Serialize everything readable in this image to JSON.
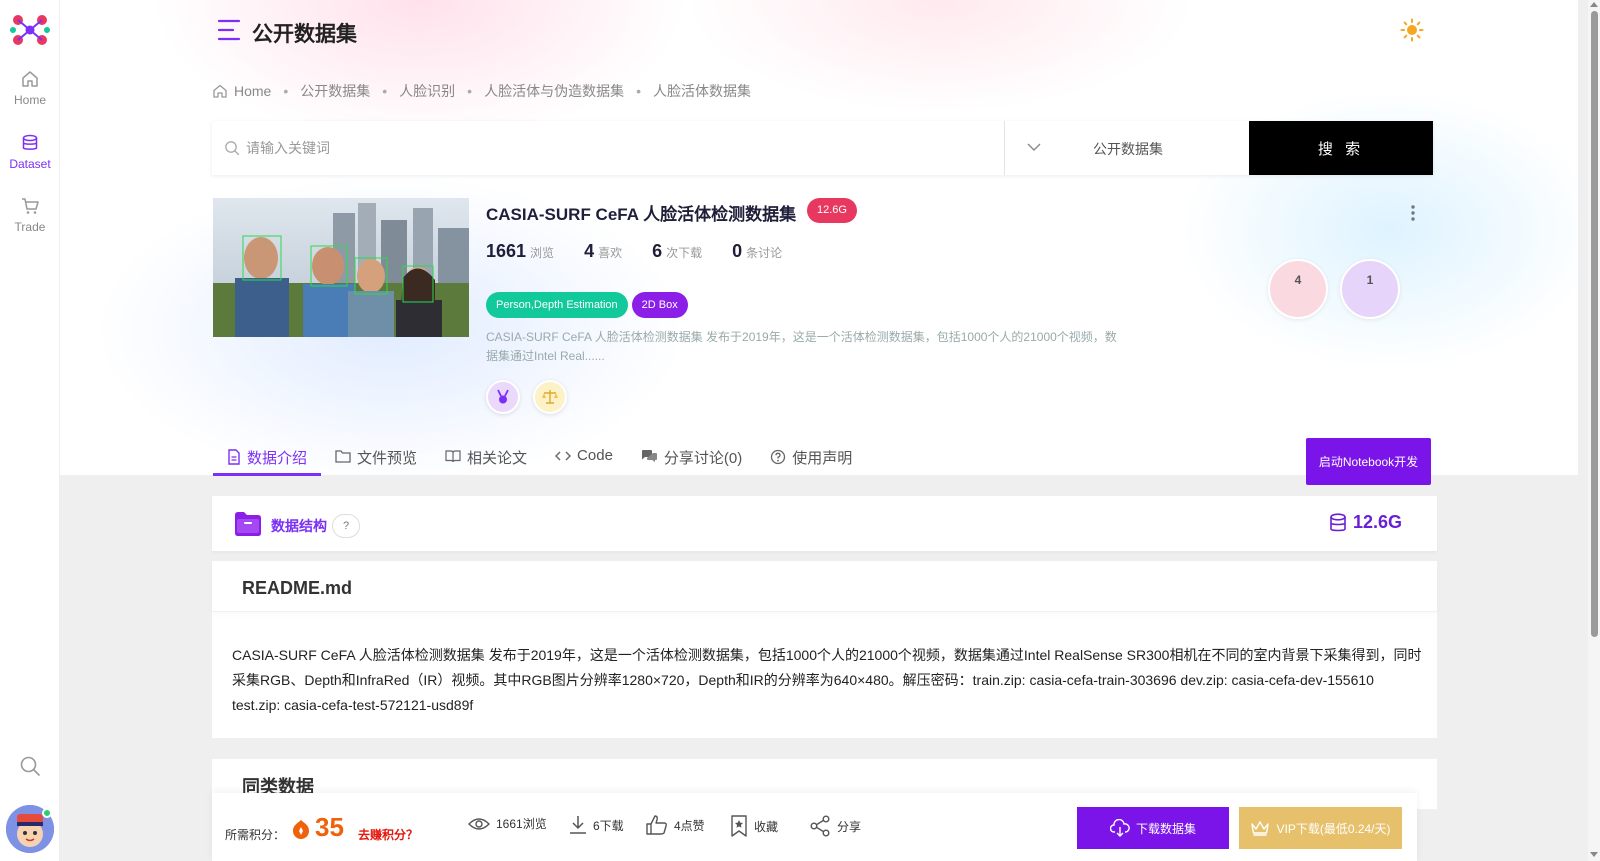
{
  "nav": {
    "items": [
      {
        "label": "Home",
        "icon": "home-icon"
      },
      {
        "label": "Dataset",
        "icon": "database-icon"
      },
      {
        "label": "Trade",
        "icon": "cart-icon"
      }
    ]
  },
  "header": {
    "title": "公开数据集"
  },
  "breadcrumb": [
    "Home",
    "公开数据集",
    "人脸识别",
    "人脸活体与伪造数据集",
    "人脸活体数据集"
  ],
  "search": {
    "placeholder": "请输入关键词",
    "category": "公开数据集",
    "button": "搜 索"
  },
  "dataset": {
    "title": "CASIA-SURF CeFA 人脸活体检测数据集",
    "size": "12.6G",
    "stats": [
      {
        "num": "1661",
        "label": "浏览"
      },
      {
        "num": "4",
        "label": "喜欢"
      },
      {
        "num": "6",
        "label": "次下载"
      },
      {
        "num": "0",
        "label": "条讨论"
      }
    ],
    "tags": [
      "Person,Depth Estimation",
      "2D Box"
    ],
    "description": "CASIA-SURF CeFA 人脸活体检测数据集 发布于2019年，这是一个活体检测数据集，包括1000个人的21000个视频，数据集通过Intel Real......",
    "bubbles": [
      "4",
      "1"
    ]
  },
  "tabs": [
    {
      "label": "数据介绍",
      "icon": "document-icon",
      "active": true
    },
    {
      "label": "文件预览",
      "icon": "folder-icon",
      "active": false
    },
    {
      "label": "相关论文",
      "icon": "book-icon",
      "active": false
    },
    {
      "label": "Code",
      "icon": "code-icon",
      "active": false
    },
    {
      "label": "分享讨论(0)",
      "icon": "chat-icon",
      "active": false
    },
    {
      "label": "使用声明",
      "icon": "question-icon",
      "active": false
    }
  ],
  "notebook_button": "启动Notebook开发",
  "structure": {
    "label": "数据结构",
    "help": "?",
    "size": "12.6G"
  },
  "readme": {
    "title": "README.md",
    "body": "CASIA-SURF CeFA 人脸活体检测数据集 发布于2019年，这是一个活体检测数据集，包括1000个人的21000个视频，数据集通过Intel RealSense SR300相机在不同的室内背景下采集得到，同时采集RGB、Depth和InfraRed（IR）视频。其中RGB图片分辨率1280×720，Depth和IR的分辨率为640×480。解压密码：train.zip: casia-cefa-train-303696 dev.zip: casia-cefa-dev-155610 test.zip: casia-cefa-test-572121-usd89f"
  },
  "similar": {
    "title": "同类数据"
  },
  "bottom": {
    "points_label": "所需积分：",
    "points": "35",
    "earn_link": "去赚积分？",
    "views": "1661浏览",
    "downloads": "6下载",
    "likes": "4点赞",
    "favorite": "收藏",
    "share": "分享",
    "download_button": "下载数据集",
    "vip_button": "VIP下载(最低0.24/天)"
  },
  "colors": {
    "accent": "#7b2ff7",
    "badge": "#e8385f",
    "tag_green": "#11c99a",
    "vip_gold": "#e6c06a"
  }
}
